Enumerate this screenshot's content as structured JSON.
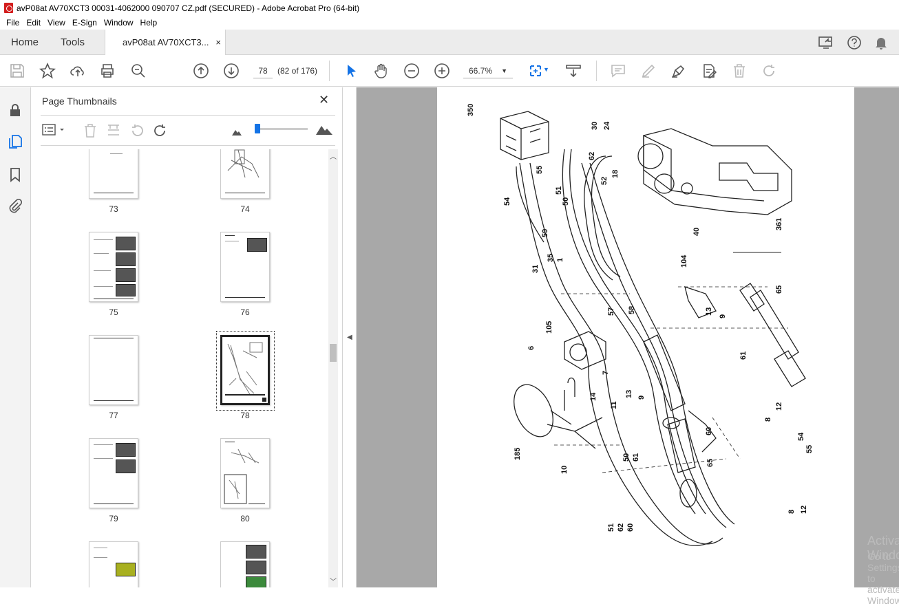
{
  "window": {
    "title": "avP08at AV70XCT3 00031-4062000 090707 CZ.pdf (SECURED) - Adobe Acrobat Pro (64-bit)"
  },
  "menu": [
    "File",
    "Edit",
    "View",
    "E-Sign",
    "Window",
    "Help"
  ],
  "tabs": {
    "home": "Home",
    "tools": "Tools",
    "document": "avP08at AV70XCT3...",
    "close": "×"
  },
  "toolbar": {
    "page_current": "78",
    "page_count": "(82 of 176)",
    "zoom": "66.7%"
  },
  "thumbnails_panel": {
    "title": "Page Thumbnails",
    "pages": [
      "73",
      "74",
      "75",
      "76",
      "77",
      "78",
      "79",
      "80"
    ],
    "selected_page": "78"
  },
  "diagram_labels": [
    "350",
    "30",
    "24",
    "55",
    "62",
    "18",
    "52",
    "54",
    "51",
    "50",
    "59",
    "361",
    "40",
    "104",
    "31",
    "35",
    "1",
    "65",
    "57",
    "58",
    "105",
    "13",
    "9",
    "6",
    "61",
    "7",
    "14",
    "11",
    "13",
    "9",
    "8",
    "12",
    "185",
    "60",
    "54",
    "55",
    "10",
    "50",
    "61",
    "65",
    "51",
    "62",
    "60",
    "8",
    "12"
  ],
  "watermark": {
    "line1": "Activate Windows",
    "line2": "Go to Settings to activate Windows."
  }
}
